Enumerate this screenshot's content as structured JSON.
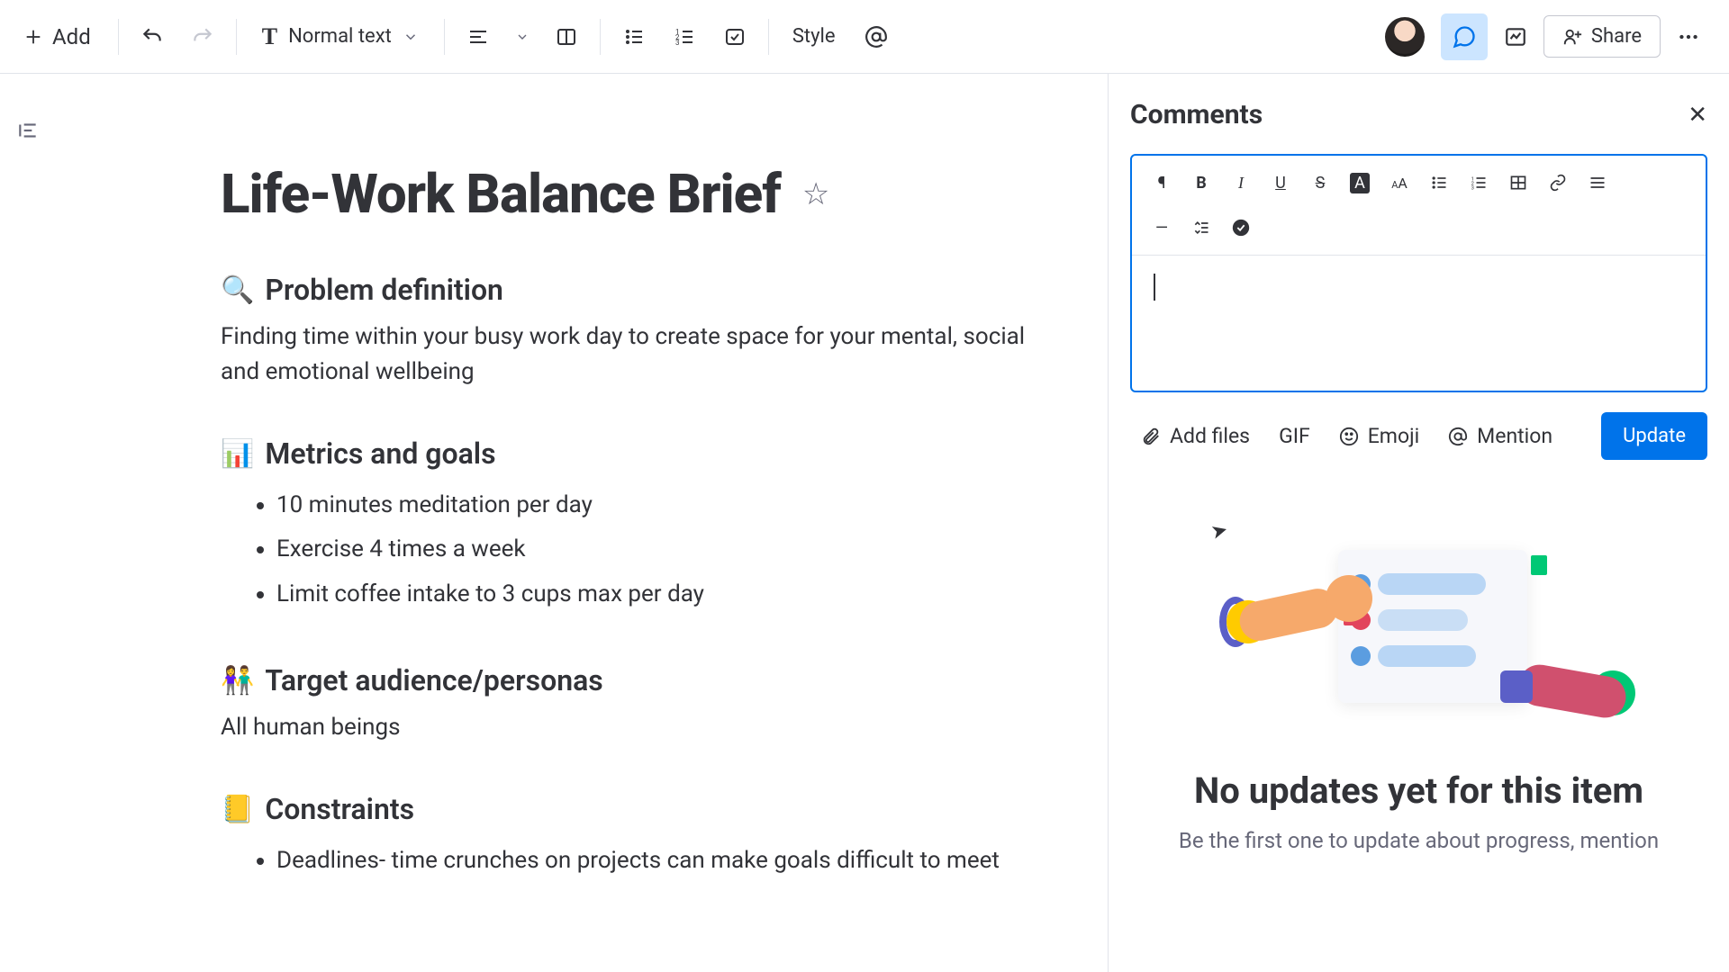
{
  "toolbar": {
    "add_label": "Add",
    "text_style_label": "Normal text",
    "style_label": "Style",
    "share_label": "Share"
  },
  "document": {
    "title": "Life-Work Balance Brief",
    "sections": {
      "problem": {
        "emoji": "🔍",
        "heading": "Problem definition",
        "body": "Finding time within your busy work day to create space for your mental, social and emotional wellbeing"
      },
      "metrics": {
        "emoji": "📊",
        "heading": "Metrics and goals",
        "items": [
          "10 minutes meditation per day",
          "Exercise 4 times a week",
          "Limit coffee intake to 3 cups max per day"
        ]
      },
      "audience": {
        "emoji": "👫",
        "heading": "Target audience/personas",
        "body": "All human beings"
      },
      "constraints": {
        "emoji": "📒",
        "heading": "Constraints",
        "items": [
          "Deadlines- time crunches on projects can make goals difficult to meet"
        ]
      }
    }
  },
  "comments": {
    "title": "Comments",
    "attach": {
      "add_files": "Add files",
      "gif": "GIF",
      "emoji": "Emoji",
      "mention": "Mention",
      "update": "Update"
    },
    "empty": {
      "title": "No updates yet for this item",
      "subtitle": "Be the first one to update about progress, mention"
    }
  },
  "colors": {
    "accent": "#0073ea"
  }
}
